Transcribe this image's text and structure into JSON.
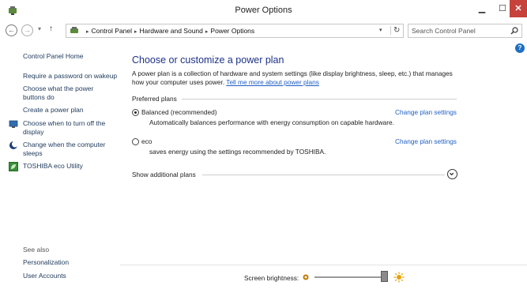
{
  "window": {
    "title": "Power Options",
    "minimize_glyph": "▁",
    "maximize_glyph": "☐",
    "close_glyph": "✕"
  },
  "address_bar": {
    "back_glyph": "←",
    "forward_glyph": "→",
    "recent_glyph": "▾",
    "up_glyph": "↑",
    "breadcrumbs": [
      "Control Panel",
      "Hardware and Sound",
      "Power Options"
    ],
    "crumb_separator": "▸",
    "dropdown_glyph": "▾",
    "refresh_glyph": "↻"
  },
  "search": {
    "placeholder": "Search Control Panel"
  },
  "sidebar": {
    "home": "Control Panel Home",
    "items": [
      {
        "label": "Require a password on wakeup"
      },
      {
        "label": "Choose what the power buttons do"
      },
      {
        "label": "Create a power plan"
      },
      {
        "label": "Choose when to turn off the display",
        "icon": "monitor-icon"
      },
      {
        "label": "Change when the computer sleeps",
        "icon": "moon-icon"
      },
      {
        "label": "TOSHIBA eco Utility",
        "icon": "eco-leaf-icon"
      }
    ],
    "see_also_label": "See also",
    "see_also": [
      "Personalization",
      "User Accounts"
    ]
  },
  "main": {
    "help_glyph": "?",
    "heading": "Choose or customize a power plan",
    "description": "A power plan is a collection of hardware and system settings (like display brightness, sleep, etc.) that manages how your computer uses power.",
    "description_link": "Tell me more about power plans",
    "preferred_label": "Preferred plans",
    "plans": [
      {
        "name": "Balanced (recommended)",
        "description": "Automatically balances performance with energy consumption on capable hardware.",
        "link": "Change plan settings",
        "selected": true
      },
      {
        "name": "eco",
        "description": "saves energy using the settings recommended by TOSHIBA.",
        "link": "Change plan settings",
        "selected": false
      }
    ],
    "show_additional": "Show additional plans"
  },
  "footer": {
    "brightness_label": "Screen brightness:",
    "brightness_level": 1.0
  },
  "colors": {
    "link": "#1f5fc4",
    "heading": "#1e3287",
    "sidebar_link": "#1e395b",
    "close_button": "#c7423a"
  }
}
